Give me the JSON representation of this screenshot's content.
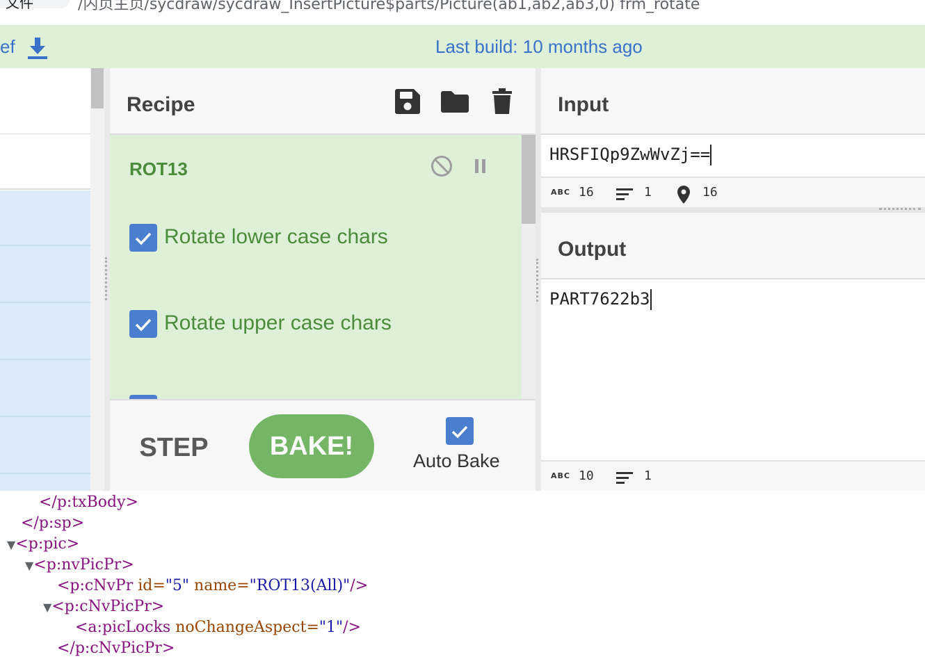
{
  "browser": {
    "tab_label": "文件",
    "url": "/内页主页/sycdraw/sycdraw_InsertPicture$parts/Picture(ab1,ab2,ab3,0) frm_rotate"
  },
  "banner": {
    "left_fragment": "ef",
    "build_text": "Last build: 10 months ago",
    "download_icon": "download-icon"
  },
  "recipe": {
    "title": "Recipe",
    "operation": {
      "name": "ROT13",
      "options": [
        {
          "label": "Rotate lower case chars",
          "checked": true
        },
        {
          "label": "Rotate upper case chars",
          "checked": true
        }
      ]
    },
    "step_label": "STEP",
    "bake_label": "BAKE!",
    "autobake_label": "Auto Bake",
    "autobake_checked": true
  },
  "input": {
    "title": "Input",
    "value": "HRSFIQp9ZwWvZj==",
    "status": {
      "length": "16",
      "lines": "1",
      "position": "16"
    }
  },
  "output": {
    "title": "Output",
    "value": "PART7622b3",
    "status": {
      "length": "10",
      "lines": "1"
    }
  },
  "devtools": {
    "lines": [
      {
        "text": "</p:txBody>"
      },
      {
        "text": "</p:sp>"
      },
      {
        "text": "<p:pic>"
      },
      {
        "text": "<p:nvPicPr>"
      },
      {
        "tag": "<p:cNvPr",
        "attr1": " id=",
        "val1": "\"5\"",
        "attr2": " name=",
        "val2": "\"ROT13(All)\"",
        "end": "/>"
      },
      {
        "text": "<p:cNvPicPr>"
      },
      {
        "tag": "<a:picLocks",
        "attr1": " noChangeAspect=",
        "val1": "\"1\"",
        "end": "/>"
      },
      {
        "text": "</p:cNvPicPr>"
      }
    ]
  },
  "colors": {
    "banner_bg": "#dff0d8",
    "link_blue": "#3a72c9",
    "op_green": "#4b8b3b",
    "bake_green": "#74b566",
    "checkbox_blue": "#4a7fd0"
  }
}
